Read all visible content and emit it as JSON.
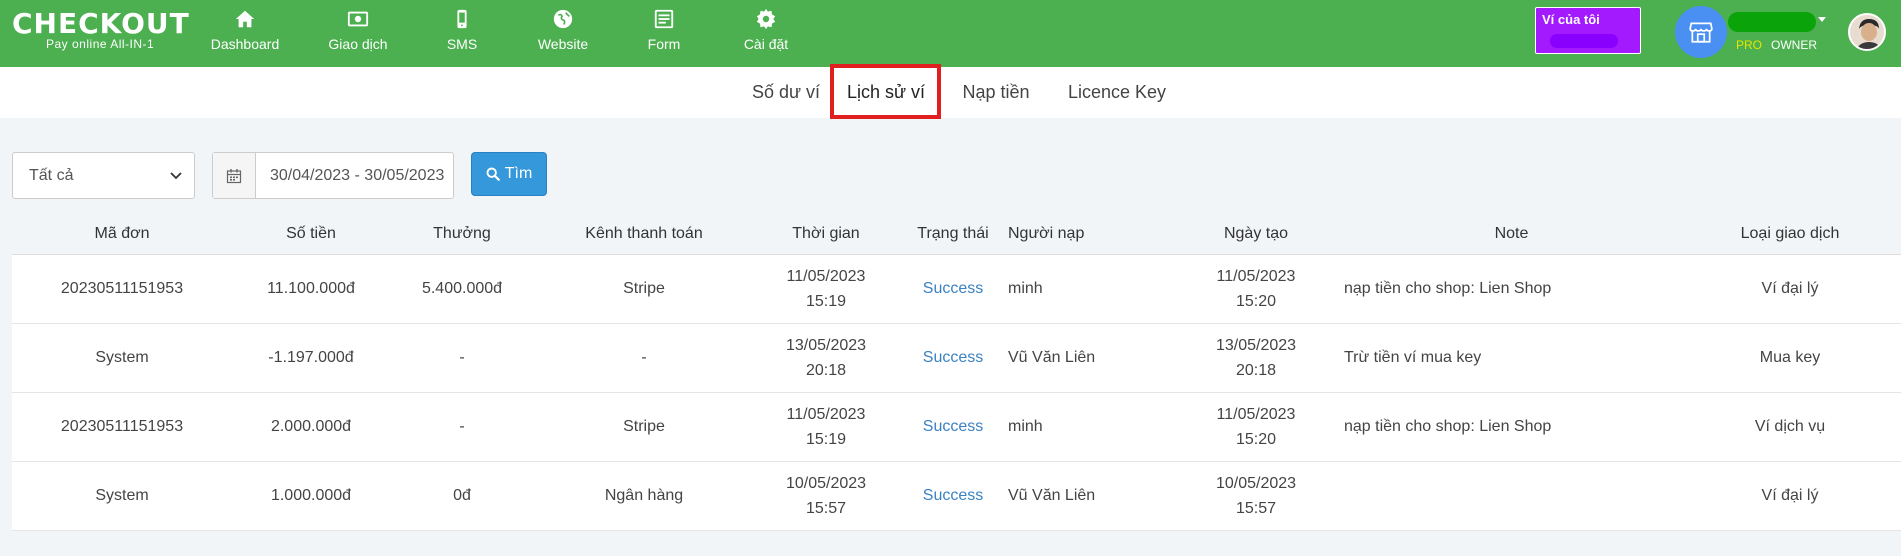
{
  "app": {
    "brand": "CHECKOUT",
    "tagline": "Pay online All-IN-1"
  },
  "nav": [
    {
      "label": "Dashboard",
      "icon": "home-icon"
    },
    {
      "label": "Giao dịch",
      "icon": "money-icon"
    },
    {
      "label": "SMS",
      "icon": "phone-icon"
    },
    {
      "label": "Website",
      "icon": "globe-icon"
    },
    {
      "label": "Form",
      "icon": "form-icon"
    },
    {
      "label": "Cài đặt",
      "icon": "gear-icon"
    }
  ],
  "header": {
    "wallet_label": "Ví của tôi",
    "role_pro": "PRO",
    "role_owner": "OWNER"
  },
  "subtabs": [
    {
      "label": "Số dư ví",
      "active": false
    },
    {
      "label": "Lịch sử ví",
      "active": true
    },
    {
      "label": "Nạp tiền",
      "active": false
    },
    {
      "label": "Licence Key",
      "active": false
    }
  ],
  "filters": {
    "type_value": "Tất cả",
    "date_range": "30/04/2023 - 30/05/2023",
    "search_label": "Tìm"
  },
  "table": {
    "columns": [
      "Mã đơn",
      "Số tiền",
      "Thưởng",
      "Kênh thanh toán",
      "Thời gian",
      "Trạng thái",
      "Người nạp",
      "Ngày tạo",
      "Note",
      "Loại giao dịch"
    ],
    "rows": [
      {
        "code": "20230511151953",
        "amount": "11.100.000đ",
        "bonus": "5.400.000đ",
        "channel": "Stripe",
        "time_date": "11/05/2023",
        "time_clock": "15:19",
        "status": "Success",
        "payer": "minh",
        "created_date": "11/05/2023",
        "created_clock": "15:20",
        "note": "nạp tiền cho shop: Lien Shop",
        "type": "Ví đại lý"
      },
      {
        "code": "System",
        "amount": "-1.197.000đ",
        "bonus": "-",
        "channel": "-",
        "time_date": "13/05/2023",
        "time_clock": "20:18",
        "status": "Success",
        "payer": "Vũ Văn Liên",
        "created_date": "13/05/2023",
        "created_clock": "20:18",
        "note": "Trừ tiền ví mua key",
        "type": "Mua key"
      },
      {
        "code": "20230511151953",
        "amount": "2.000.000đ",
        "bonus": "-",
        "channel": "Stripe",
        "time_date": "11/05/2023",
        "time_clock": "15:19",
        "status": "Success",
        "payer": "minh",
        "created_date": "11/05/2023",
        "created_clock": "15:20",
        "note": "nạp tiền cho shop: Lien Shop",
        "type": "Ví dịch vụ"
      },
      {
        "code": "System",
        "amount": "1.000.000đ",
        "bonus": "0đ",
        "channel": "Ngân hàng",
        "time_date": "10/05/2023",
        "time_clock": "15:57",
        "status": "Success",
        "payer": "Vũ Văn Liên",
        "created_date": "10/05/2023",
        "created_clock": "15:57",
        "note": "",
        "type": "Ví đại lý"
      }
    ]
  },
  "colors": {
    "topbar": "#4caf50",
    "wallet": "#a31aff",
    "accent": "#3498db",
    "status_success": "#3b82c4",
    "active_frame": "#e02020"
  }
}
